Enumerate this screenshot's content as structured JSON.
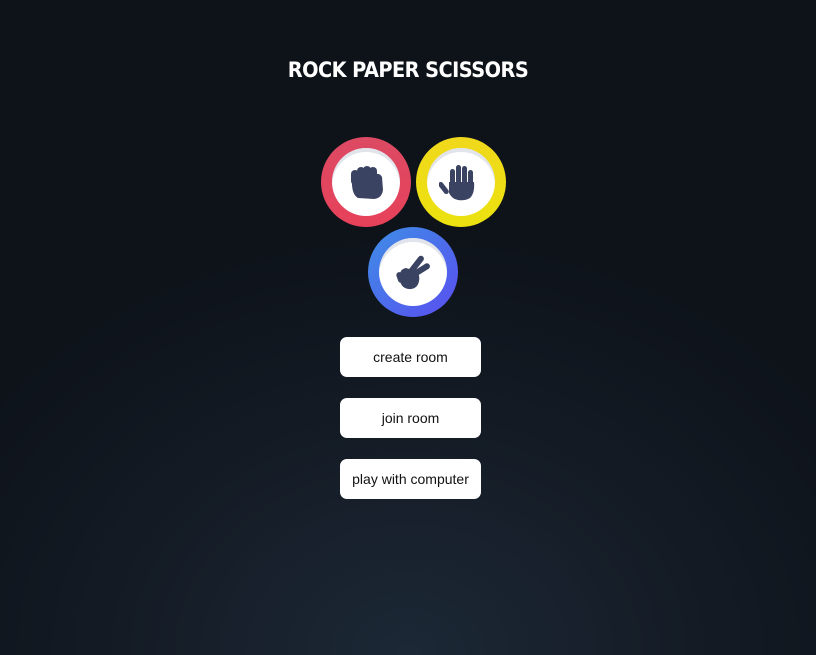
{
  "app": {
    "title": "ROCK PAPER SCISSORS"
  },
  "choices": [
    {
      "id": "rock",
      "icon": "fist-icon",
      "ring_color": "#e3475f"
    },
    {
      "id": "paper",
      "icon": "open-hand-icon",
      "ring_color": "#efde14"
    },
    {
      "id": "scissors",
      "icon": "peace-hand-icon",
      "ring_color": "#4a6ee9"
    }
  ],
  "menu": {
    "create_room_label": "create room",
    "join_room_label": "join room",
    "play_computer_label": "play with computer"
  },
  "colors": {
    "icon": "#3b4363",
    "background": "#141b25"
  }
}
